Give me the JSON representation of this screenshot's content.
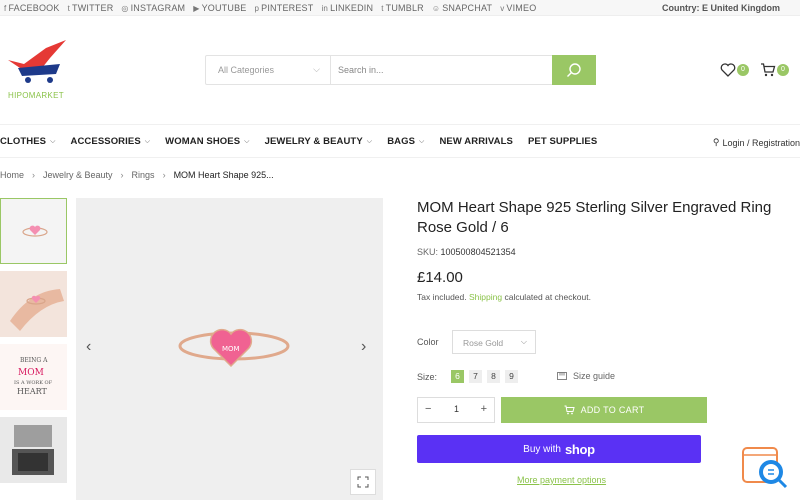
{
  "topbar": {
    "social": [
      {
        "icon": "facebook-icon",
        "glyph": "f",
        "label": "FACEBOOK"
      },
      {
        "icon": "twitter-icon",
        "glyph": "t",
        "label": "TWITTER"
      },
      {
        "icon": "instagram-icon",
        "glyph": "◎",
        "label": "INSTAGRAM"
      },
      {
        "icon": "youtube-icon",
        "glyph": "▶",
        "label": "YOUTUBE"
      },
      {
        "icon": "pinterest-icon",
        "glyph": "p",
        "label": "PINTEREST"
      },
      {
        "icon": "linkedin-icon",
        "glyph": "in",
        "label": "LINKEDIN"
      },
      {
        "icon": "tumblr-icon",
        "glyph": "t",
        "label": "TUMBLR"
      },
      {
        "icon": "snapchat-icon",
        "glyph": "☺",
        "label": "SNAPCHAT"
      },
      {
        "icon": "vimeo-icon",
        "glyph": "v",
        "label": "VIMEO"
      }
    ],
    "country": "Country: E United Kingdom"
  },
  "header": {
    "logo_text": "HIPOMARKET",
    "category_label": "All Categories",
    "search_placeholder": "Search in...",
    "wishlist_count": "0",
    "cart_count": "0"
  },
  "nav": {
    "items": [
      {
        "label": "CLOTHES",
        "dropdown": "⌵"
      },
      {
        "label": "ACCESSORIES",
        "dropdown": "⌵"
      },
      {
        "label": "WOMAN SHOES",
        "dropdown": "⌵"
      },
      {
        "label": "JEWELRY & BEAUTY",
        "dropdown": "⌵"
      },
      {
        "label": "BAGS",
        "dropdown": "⌵"
      },
      {
        "label": "NEW ARRIVALS",
        "dropdown": ""
      },
      {
        "label": "PET SUPPLIES",
        "dropdown": ""
      }
    ],
    "login_label": "Login / Registration"
  },
  "breadcrumb": {
    "items": [
      "Home",
      "Jewelry & Beauty",
      "Rings"
    ],
    "current": "MOM Heart Shape 925..."
  },
  "gallery": {
    "thumb_text": [
      "BEING A",
      "MOM",
      "IS A WORK OF",
      "HEART"
    ],
    "ring_engraving": "MOM"
  },
  "product": {
    "title": "MOM Heart Shape 925 Sterling Silver Engraved Ring Rose Gold / 6",
    "sku_label": "SKU:",
    "sku_value": "100500804521354",
    "price": "£14.00",
    "tax_prefix": "Tax included.",
    "tax_link": "Shipping",
    "tax_suffix": "calculated at checkout.",
    "color_label": "Color",
    "color_value": "Rose Gold",
    "size_label": "Size:",
    "sizes": [
      "6",
      "7",
      "8",
      "9"
    ],
    "selected_size": "6",
    "size_guide": "Size guide",
    "quantity": "1",
    "add_to_cart": "ADD TO CART",
    "buy_with": "Buy with",
    "buy_brand": "shop",
    "more_options": "More payment options"
  },
  "colors": {
    "accent": "#9ac765",
    "shop_pay": "#5a31f4",
    "logo_red": "#e53935"
  }
}
